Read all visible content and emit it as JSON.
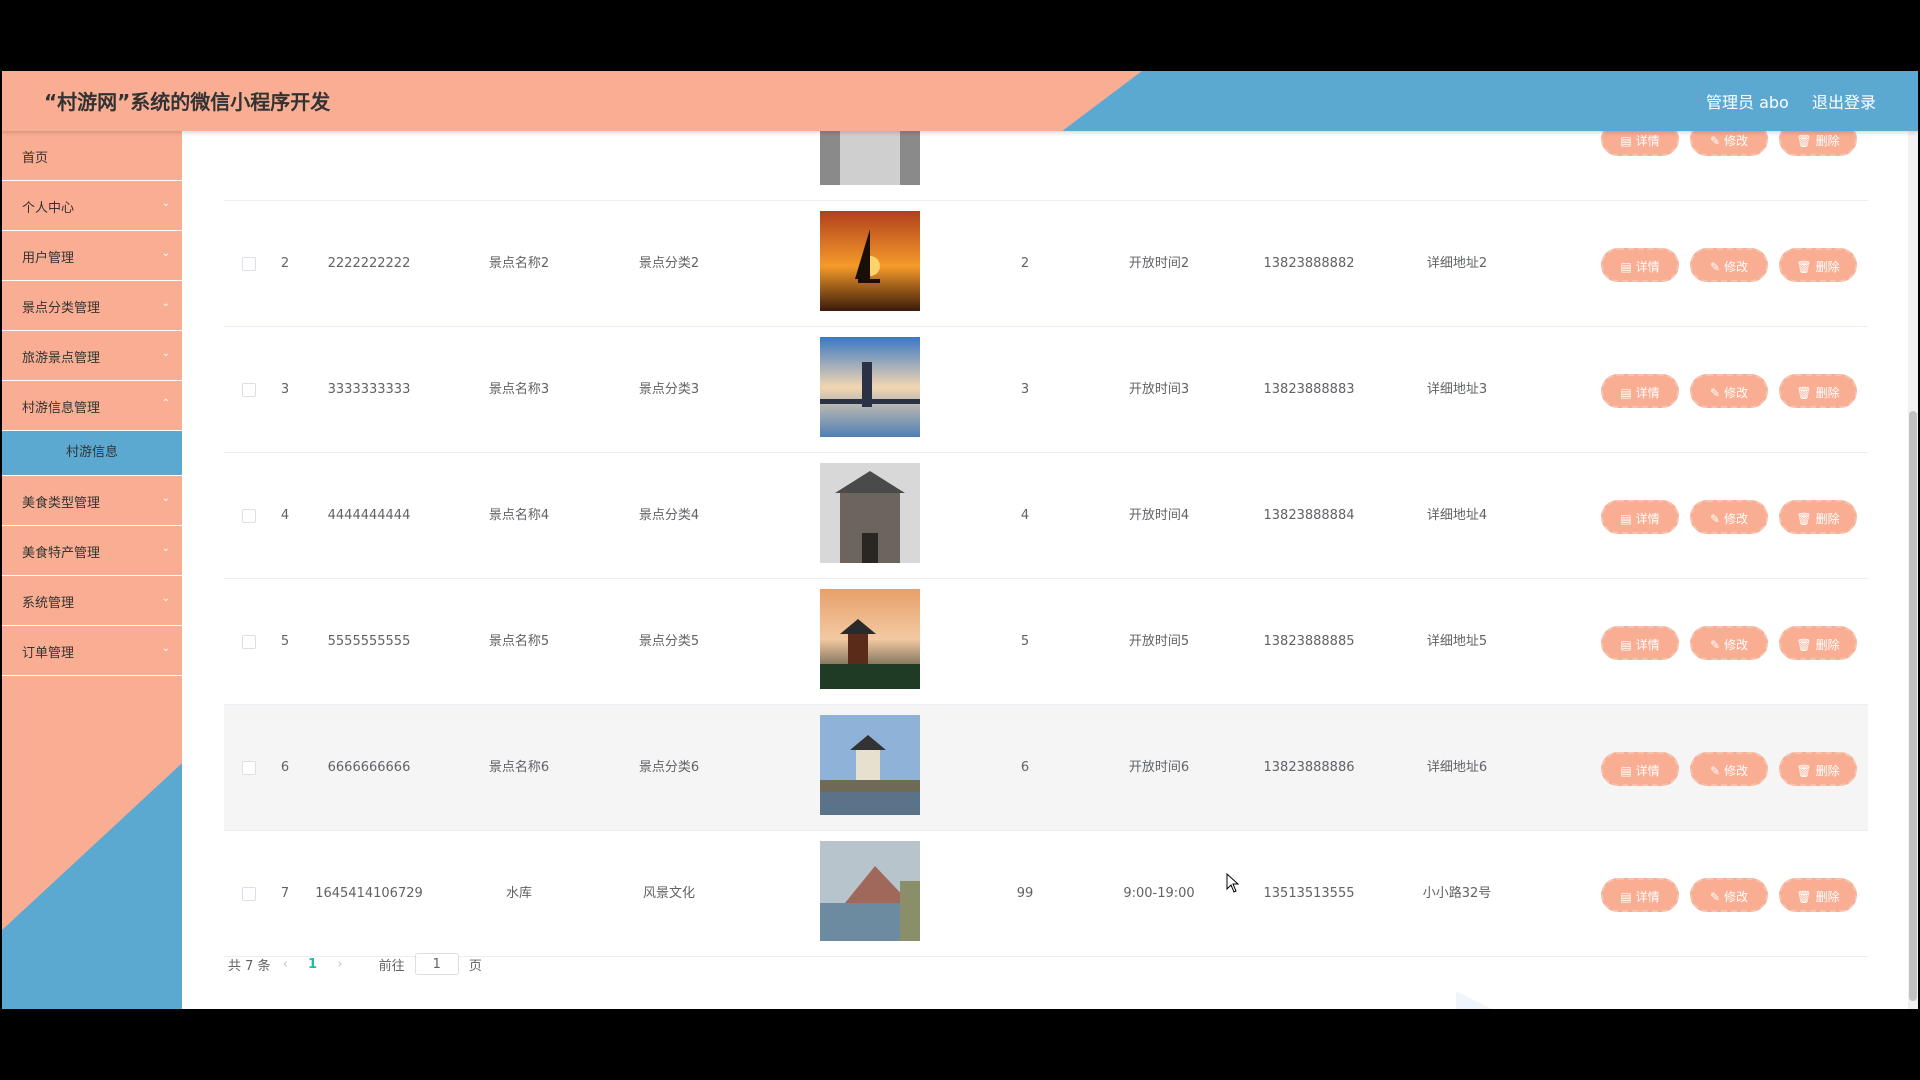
{
  "header": {
    "title": "“村游网”系统的微信小程序开发",
    "user": "管理员 abo",
    "logout": "退出登录"
  },
  "sidebar": {
    "items": [
      {
        "label": "首页"
      },
      {
        "label": "个人中心"
      },
      {
        "label": "用户管理"
      },
      {
        "label": "景点分类管理"
      },
      {
        "label": "旅游景点管理"
      },
      {
        "label": "村游信息管理"
      },
      {
        "label": "村游信息"
      },
      {
        "label": "美食类型管理"
      },
      {
        "label": "美食特产管理"
      },
      {
        "label": "系统管理"
      },
      {
        "label": "订单管理"
      }
    ]
  },
  "table": {
    "rows": [
      {
        "index": "",
        "id": "",
        "name": "",
        "category": "",
        "num": "",
        "hours": "",
        "phone": "",
        "address": ""
      },
      {
        "index": "2",
        "id": "2222222222",
        "name": "景点名称2",
        "category": "景点分类2",
        "num": "2",
        "hours": "开放时间2",
        "phone": "13823888882",
        "address": "详细地址2"
      },
      {
        "index": "3",
        "id": "3333333333",
        "name": "景点名称3",
        "category": "景点分类3",
        "num": "3",
        "hours": "开放时间3",
        "phone": "13823888883",
        "address": "详细地址3"
      },
      {
        "index": "4",
        "id": "4444444444",
        "name": "景点名称4",
        "category": "景点分类4",
        "num": "4",
        "hours": "开放时间4",
        "phone": "13823888884",
        "address": "详细地址4"
      },
      {
        "index": "5",
        "id": "5555555555",
        "name": "景点名称5",
        "category": "景点分类5",
        "num": "5",
        "hours": "开放时间5",
        "phone": "13823888885",
        "address": "详细地址5"
      },
      {
        "index": "6",
        "id": "6666666666",
        "name": "景点名称6",
        "category": "景点分类6",
        "num": "6",
        "hours": "开放时间6",
        "phone": "13823888886",
        "address": "详细地址6"
      },
      {
        "index": "7",
        "id": "1645414106729",
        "name": "水库",
        "category": "风景文化",
        "num": "99",
        "hours": "9:00-19:00",
        "phone": "13513513555",
        "address": "小小路32号"
      }
    ],
    "actions": {
      "detail": "详情",
      "edit": "修改",
      "delete": "删除"
    }
  },
  "pagination": {
    "total": "共 7 条",
    "current": "1",
    "goto_prefix": "前往",
    "goto_value": "1",
    "goto_suffix": "页"
  },
  "colors": {
    "salmon": "#f9ae93",
    "blue": "#5ba9d1"
  }
}
